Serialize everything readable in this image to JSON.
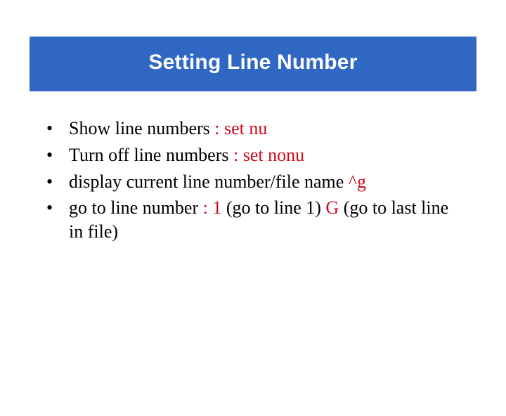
{
  "title": "Setting Line Number",
  "bullets": [
    {
      "pre": "Show line numbers ",
      "cmd": ": set nu",
      "post": ""
    },
    {
      "pre": "Turn off line numbers ",
      "cmd": ": set nonu",
      "post": ""
    },
    {
      "pre": "display current line number/file name ",
      "cmd": "^g",
      "post": ""
    },
    {
      "pre": "go to line number  ",
      "cmd": ": 1",
      "mid": " (go to line 1) ",
      "cmd2": "G",
      "post": "  (go to last line in file)"
    }
  ]
}
